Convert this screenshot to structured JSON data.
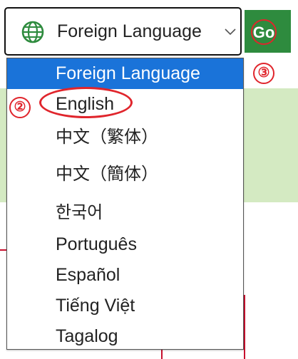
{
  "select": {
    "selected_label": "Foreign Language",
    "icon": "globe-icon",
    "chevron_icon": "chevron-down-icon"
  },
  "go_button": {
    "label": "Go"
  },
  "dropdown": {
    "options": [
      "Foreign Language",
      "English",
      "中文（繁体）",
      "中文（簡体）",
      "한국어",
      "Português",
      "Español",
      "Tiếng Việt",
      "Tagalog"
    ],
    "highlighted_index": 0
  },
  "callouts": {
    "english": "②",
    "go": "③"
  },
  "colors": {
    "accent_red": "#e0252c",
    "go_green": "#2e8b3e",
    "selected_blue": "#1a73d9",
    "band_green": "#d4eac2"
  }
}
